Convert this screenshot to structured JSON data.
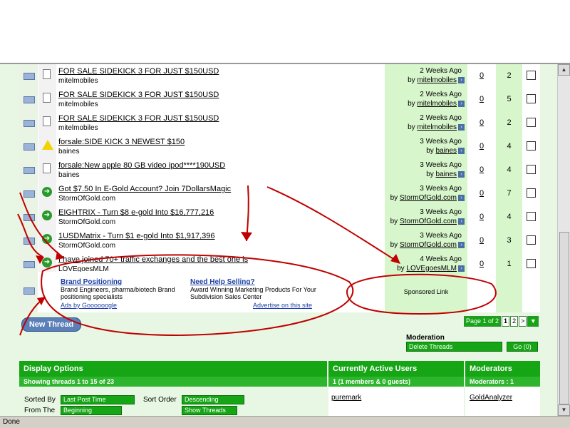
{
  "threads": [
    {
      "title": "FOR SALE SIDEKICK 3 FOR JUST $150USD",
      "author": "mitelmobiles",
      "icon": "document-icon",
      "when": "2 Weeks Ago",
      "by_prefix": "by",
      "last_poster": "mitelmobiles",
      "replies": "0",
      "views": "2"
    },
    {
      "title": "FOR SALE SIDEKICK 3 FOR JUST $150USD",
      "author": "mitelmobiles",
      "icon": "document-icon",
      "when": "2 Weeks Ago",
      "by_prefix": "by",
      "last_poster": "mitelmobiles",
      "replies": "0",
      "views": "5"
    },
    {
      "title": "FOR SALE SIDEKICK 3 FOR JUST $150USD",
      "author": "mitelmobiles",
      "icon": "document-icon",
      "when": "2 Weeks Ago",
      "by_prefix": "by",
      "last_poster": "mitelmobiles",
      "replies": "0",
      "views": "2"
    },
    {
      "title": "forsale:SIDE KICK 3 NEWEST $150",
      "author": "baines",
      "icon": "warning-icon",
      "when": "3 Weeks Ago",
      "by_prefix": "by",
      "last_poster": "baines",
      "replies": "0",
      "views": "4"
    },
    {
      "title": "forsale:New apple 80 GB video ipod****190USD",
      "author": "baines",
      "icon": "document-icon",
      "when": "3 Weeks Ago",
      "by_prefix": "by",
      "last_poster": "baines",
      "replies": "0",
      "views": "4"
    },
    {
      "title": "Got $7.50 In E-Gold Account? Join 7DollarsMagic",
      "author": "StormOfGold.com",
      "icon": "arrow-right-icon",
      "when": "3 Weeks Ago",
      "by_prefix": "by",
      "last_poster": "StormOfGold.com",
      "replies": "0",
      "views": "7"
    },
    {
      "title": "EIGHTRIX - Turn $8 e-gold Into $16,777,216",
      "author": "StormOfGold.com",
      "icon": "arrow-right-icon",
      "when": "3 Weeks Ago",
      "by_prefix": "by",
      "last_poster": "StormOfGold.com",
      "replies": "0",
      "views": "4"
    },
    {
      "title": "1USDMatrix - Turn $1 e-gold Into $1,917,396",
      "author": "StormOfGold.com",
      "icon": "arrow-right-icon",
      "when": "3 Weeks Ago",
      "by_prefix": "by",
      "last_poster": "StormOfGold.com",
      "replies": "0",
      "views": "3"
    },
    {
      "title": "I have joined 70+ traffic exchanges and the best one is",
      "author": "LOVEgoesMLM",
      "icon": "arrow-right-icon",
      "when": "4 Weeks Ago",
      "by_prefix": "by",
      "last_poster": "LOVEgoesMLM",
      "replies": "0",
      "views": "1"
    }
  ],
  "ads": {
    "ad1_title": "Brand Positioning",
    "ad1_text": "Brand Engineers, pharma/biotech Brand positioning specialists",
    "ad2_title": "Need Help Selling?",
    "ad2_text": "Award Winning Marketing Products For Your Subdivision Sales Center",
    "ads_by": "Ads by Goooooogle",
    "advertise": "Advertise on this site",
    "sponsored": "Sponsored Link"
  },
  "new_thread_label": "New Thread",
  "pager": {
    "page_of": "Page 1 of 2",
    "current": "1",
    "next_page": "2",
    "next_arrow": ">"
  },
  "moderation": {
    "label": "Moderation",
    "selected": "Delete Threads",
    "go_label": "Go (0)"
  },
  "display_options": {
    "title": "Display Options",
    "showing": "Showing threads 1 to 15 of 23",
    "sorted_by_label": "Sorted By",
    "sorted_by_value": "Last Post Time",
    "sort_order_label": "Sort Order",
    "sort_order_value": "Descending",
    "from_label": "From The",
    "from_value": "Beginning",
    "show_button": "Show Threads"
  },
  "active_users": {
    "title": "Currently Active Users",
    "summary": "1 (1 members & 0 guests)",
    "user": "puremark"
  },
  "moderators": {
    "title": "Moderators",
    "summary": "Moderators : 1",
    "name": "GoldAnalyzer"
  },
  "status": "Done",
  "colors": {
    "header_green": "#15a515",
    "annotation_red": "#c00000"
  }
}
